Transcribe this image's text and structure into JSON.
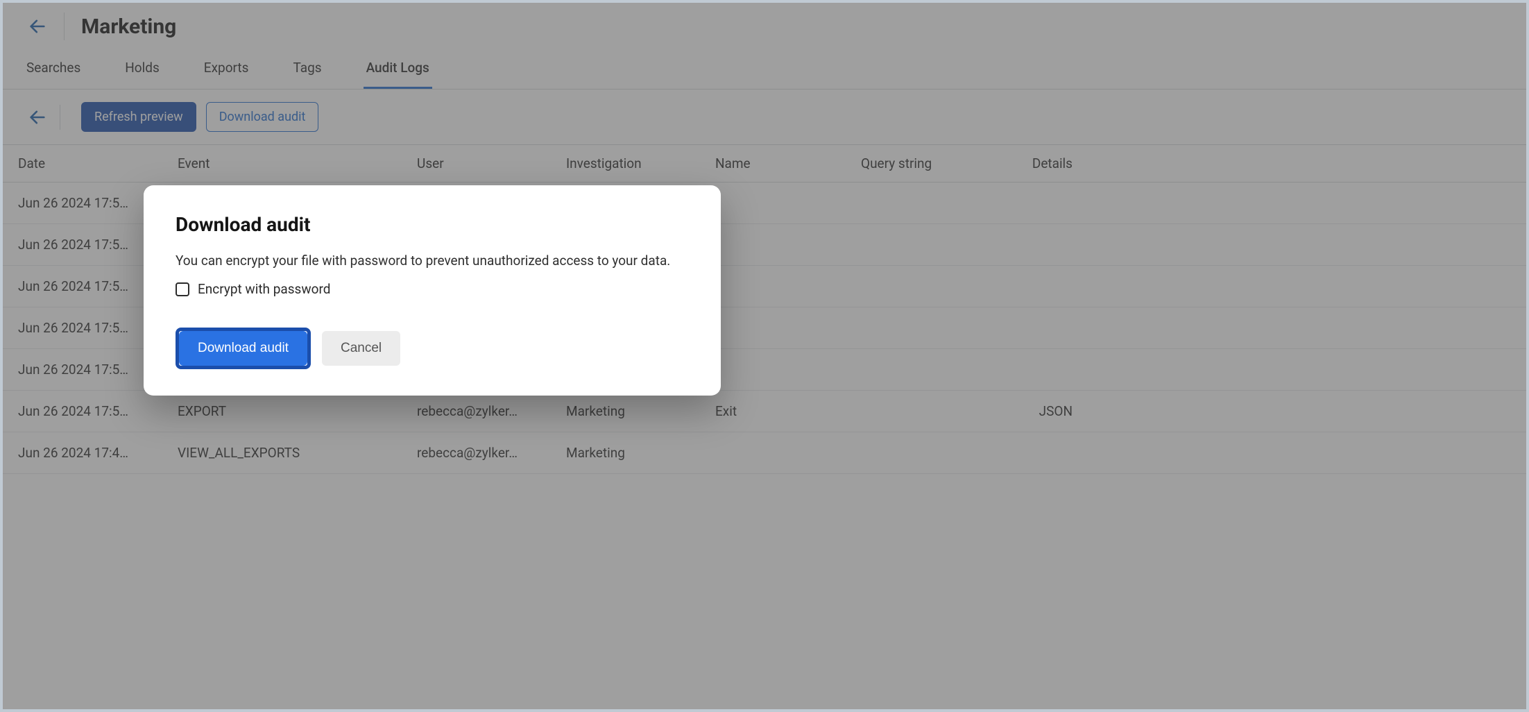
{
  "header": {
    "title": "Marketing"
  },
  "tabs": [
    {
      "label": "Searches"
    },
    {
      "label": "Holds"
    },
    {
      "label": "Exports"
    },
    {
      "label": "Tags"
    },
    {
      "label": "Audit Logs",
      "active": true
    }
  ],
  "toolbar": {
    "refresh_label": "Refresh preview",
    "download_label": "Download audit"
  },
  "table": {
    "headers": {
      "date": "Date",
      "event": "Event",
      "user": "User",
      "investigation": "Investigation",
      "name": "Name",
      "query": "Query string",
      "details": "Details"
    },
    "rows": [
      {
        "date": "Jun 26 2024 17:5…",
        "event": "",
        "user": "",
        "investigation": "",
        "name": "",
        "query": "",
        "details": ""
      },
      {
        "date": "Jun 26 2024 17:5…",
        "event": "",
        "user": "",
        "investigation": "",
        "name": "",
        "query": "",
        "details": ""
      },
      {
        "date": "Jun 26 2024 17:5…",
        "event": "",
        "user": "",
        "investigation": "",
        "name": "",
        "query": "",
        "details": ""
      },
      {
        "date": "Jun 26 2024 17:5…",
        "event": "",
        "user": "",
        "investigation": "",
        "name": "",
        "query": "",
        "details": ""
      },
      {
        "date": "Jun 26 2024 17:5…",
        "event": "",
        "user": "",
        "investigation": "",
        "name": "",
        "query": "",
        "details": ""
      },
      {
        "date": "Jun 26 2024 17:5…",
        "event": "EXPORT",
        "user": "rebecca@zylker…",
        "investigation": "Marketing",
        "name": "Exit",
        "query": "",
        "details": "JSON"
      },
      {
        "date": "Jun 26 2024 17:4…",
        "event": "VIEW_ALL_EXPORTS",
        "user": "rebecca@zylker…",
        "investigation": "Marketing",
        "name": "",
        "query": "",
        "details": ""
      }
    ]
  },
  "modal": {
    "title": "Download audit",
    "description": "You can encrypt your file with password to prevent unauthorized access to your data.",
    "checkbox_label": "Encrypt with password",
    "primary_label": "Download audit",
    "cancel_label": "Cancel"
  }
}
